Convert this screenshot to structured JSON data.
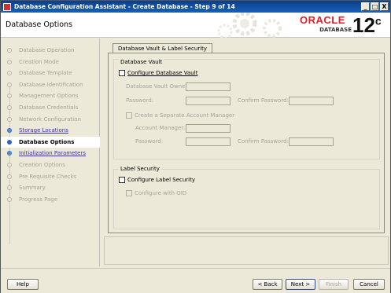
{
  "window": {
    "title": "Database Configuration Assistant - Create Database - Step 9 of 14",
    "minimize_glyph": "_",
    "maximize_glyph": "□",
    "close_glyph": "X"
  },
  "header": {
    "title": "Database Options",
    "logo_word": "ORACLE",
    "logo_sub": "DATABASE",
    "logo_version": "12",
    "logo_version_suffix": "c",
    "logo_color": "#e21e26"
  },
  "steps": [
    {
      "label": "Database Operation",
      "state": "disabled"
    },
    {
      "label": "Creation Mode",
      "state": "disabled"
    },
    {
      "label": "Database Template",
      "state": "disabled"
    },
    {
      "label": "Database Identification",
      "state": "disabled"
    },
    {
      "label": "Management Options",
      "state": "disabled"
    },
    {
      "label": "Database Credentials",
      "state": "disabled"
    },
    {
      "label": "Network Configuration",
      "state": "disabled"
    },
    {
      "label": "Storage Locations",
      "state": "link"
    },
    {
      "label": "Database Options",
      "state": "current"
    },
    {
      "label": "Initialization Parameters",
      "state": "link"
    },
    {
      "label": "Creation Options",
      "state": "disabled"
    },
    {
      "label": "Pre Requisite Checks",
      "state": "disabled"
    },
    {
      "label": "Summary",
      "state": "disabled"
    },
    {
      "label": "Progress Page",
      "state": "disabled"
    }
  ],
  "tab": {
    "label": "Database Vault & Label Security"
  },
  "vault": {
    "group_title": "Database Vault",
    "configure_label": "Configure Database Vault",
    "configure_checked": false,
    "owner_label": "Database Vault Owner:",
    "owner_value": "",
    "password_label": "Password:",
    "password_value": "",
    "confirm_label": "Confirm Password:",
    "confirm_value": "",
    "separate_label": "Create a Separate Account Manager",
    "separate_checked": false,
    "manager_label": "Account Manager:",
    "manager_value": "",
    "mgr_password_label": "Password:",
    "mgr_password_value": "",
    "mgr_confirm_label": "Confirm Password:",
    "mgr_confirm_value": ""
  },
  "label_security": {
    "group_title": "Label Security",
    "configure_label": "Configure Label Security",
    "configure_checked": false,
    "oid_label": "Configure with OID",
    "oid_checked": false
  },
  "footer": {
    "help": "Help",
    "back": "< Back",
    "next": "Next >",
    "finish": "Finish",
    "cancel": "Cancel"
  }
}
